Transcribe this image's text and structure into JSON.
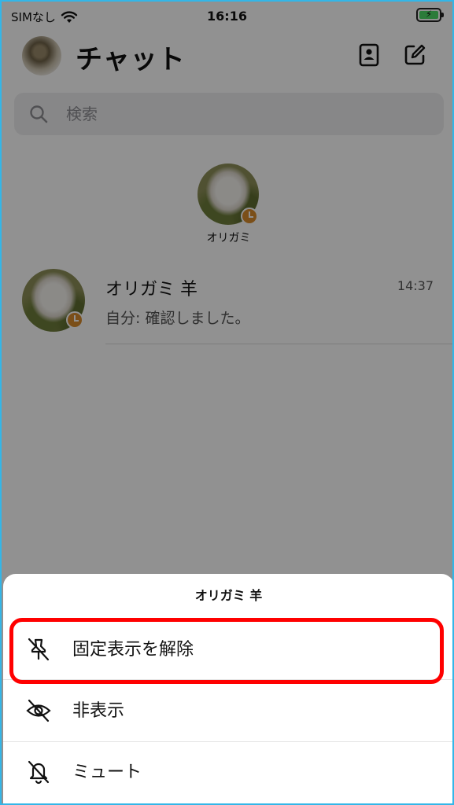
{
  "status_bar": {
    "carrier": "SIMなし",
    "time": "16:16"
  },
  "header": {
    "title": "チャット"
  },
  "search": {
    "placeholder": "検索"
  },
  "pinned": {
    "name": "オリガミ"
  },
  "chat": {
    "name": "オリガミ 羊",
    "time": "14:37",
    "preview": "自分: 確認しました。"
  },
  "sheet": {
    "title": "オリガミ 羊",
    "items": [
      {
        "label": "固定表示を解除",
        "icon": "unpin-icon"
      },
      {
        "label": "非表示",
        "icon": "eye-off-icon"
      },
      {
        "label": "ミュート",
        "icon": "bell-off-icon"
      }
    ]
  },
  "colors": {
    "highlight": "#ff0000",
    "badge": "#d98c2c",
    "frame": "#33b6e8",
    "battery": "#4cd964"
  }
}
